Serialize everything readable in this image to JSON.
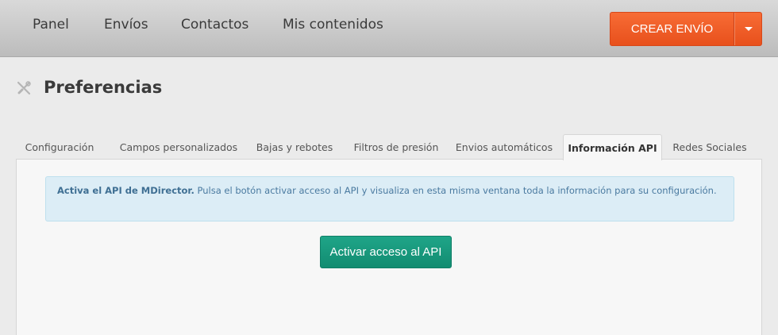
{
  "nav": {
    "items": [
      {
        "label": "Panel"
      },
      {
        "label": "Envíos"
      },
      {
        "label": "Contactos"
      },
      {
        "label": "Mis contenidos"
      }
    ],
    "create_label": "CREAR ENVÍO"
  },
  "page": {
    "title": "Preferencias",
    "icon": "tools-icon"
  },
  "tabs": [
    {
      "label": "Configuración"
    },
    {
      "label": "Campos personalizados"
    },
    {
      "label": "Bajas y rebotes"
    },
    {
      "label": "Filtros de presión"
    },
    {
      "label": "Envios automáticos"
    },
    {
      "label": "Información API",
      "active": true
    },
    {
      "label": "Redes Sociales"
    }
  ],
  "api_panel": {
    "alert_strong": "Activa el API de MDirector.",
    "alert_text": " Pulsa el botón activar acceso al API y visualiza en esta misma ventana toda la información para su configuración.",
    "button_label": "Activar acceso al API"
  },
  "colors": {
    "accent_orange": "#f0602a",
    "accent_green": "#179a7d",
    "info_bg": "#dcedf6"
  }
}
